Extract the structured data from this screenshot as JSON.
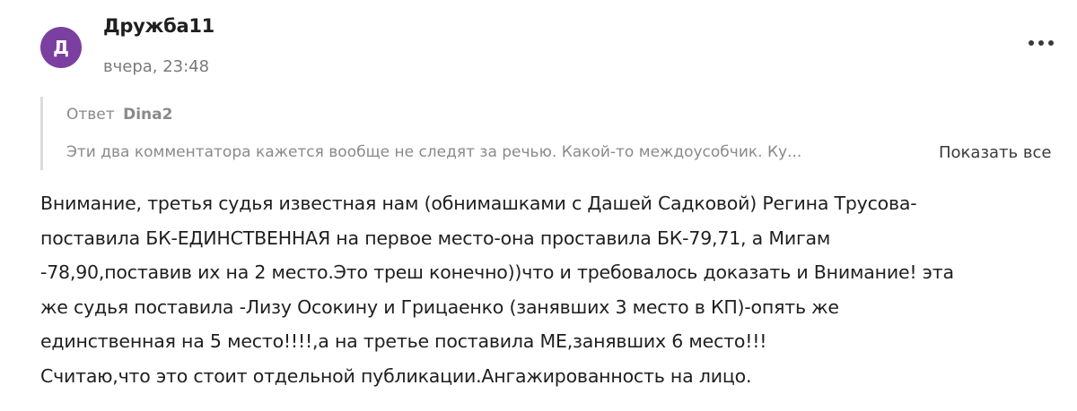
{
  "comment": {
    "avatar_letter": "Д",
    "avatar_color": "#7b3fa0",
    "author": "Дружба11",
    "timestamp": "вчера, 23:48",
    "more_icon": "more-horizontal-icon",
    "reply": {
      "prefix": "Ответ",
      "author": "Dina2",
      "excerpt": "Эти два комментатора кажется вообще не следят за речью. Какой-то междоусобчик. Ку...",
      "show_all_label": "Показать все"
    },
    "body_lines": [
      "Внимание, третья судья известная нам (обнимашками с Дашей Садковой) Регина Трусова-",
      "поставила БК-ЕДИНСТВЕННАЯ на первое место-она проставила БК-79,71, а Мигам",
      "-78,90,поставив их на 2 место.Это треш конечно))что и требовалось доказать и Внимание! эта",
      "же судья поставила -Лизу Осокину и Грицаенко (занявших 3 место в КП)-опять же",
      "единственная на 5 место!!!!,а на третье поставила МЕ,занявших 6 место!!!",
      "Считаю,что это стоит отдельной публикации.Ангажированность на лицо."
    ]
  }
}
